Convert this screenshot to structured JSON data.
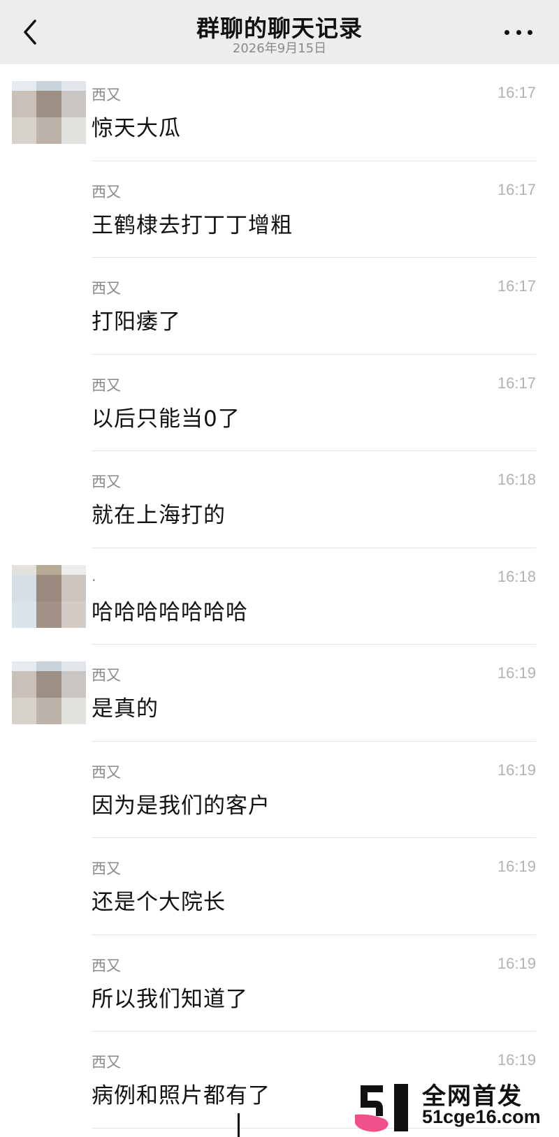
{
  "header": {
    "title": "群聊的聊天记录",
    "date": "2026年9月15日"
  },
  "messages": [
    {
      "sender": "西又",
      "time": "16:17",
      "text": "惊天大瓜",
      "avatar": "a"
    },
    {
      "sender": "西又",
      "time": "16:17",
      "text": "王鹤棣去打丁丁增粗",
      "avatar": ""
    },
    {
      "sender": "西又",
      "time": "16:17",
      "text": "打阳痿了",
      "avatar": ""
    },
    {
      "sender": "西又",
      "time": "16:17",
      "text": "以后只能当0了",
      "avatar": ""
    },
    {
      "sender": "西又",
      "time": "16:18",
      "text": "就在上海打的",
      "avatar": ""
    },
    {
      "sender": ".",
      "time": "16:18",
      "text": "哈哈哈哈哈哈哈",
      "avatar": "b"
    },
    {
      "sender": "西又",
      "time": "16:19",
      "text": "是真的",
      "avatar": "a"
    },
    {
      "sender": "西又",
      "time": "16:19",
      "text": "因为是我们的客户",
      "avatar": ""
    },
    {
      "sender": "西又",
      "time": "16:19",
      "text": "还是个大院长",
      "avatar": ""
    },
    {
      "sender": "西又",
      "time": "16:19",
      "text": "所以我们知道了",
      "avatar": ""
    },
    {
      "sender": "西又",
      "time": "16:19",
      "text": "病例和照片都有了",
      "avatar": ""
    }
  ],
  "avatar_palettes": {
    "a": [
      "#e6ebef",
      "#c8d3dc",
      "#e2e6ea",
      "#c9c0b8",
      "#9c8f86",
      "#c8c5c2",
      "#d8d2cc",
      "#bdb3ab",
      "#e3e1de"
    ],
    "b": [
      "#e4e0dc",
      "#b8ab96",
      "#ececec",
      "#d5dde5",
      "#9b8a80",
      "#cdc5bd",
      "#dde3ea",
      "#a39287",
      "#d2cbc6"
    ]
  },
  "watermark": {
    "line1": "全网首发",
    "line2": "51cge16.com",
    "logo_colors": [
      "#111111",
      "#f0508a"
    ]
  },
  "icons": {
    "back": "chevron-left-icon",
    "more": "more-horizontal-icon"
  }
}
